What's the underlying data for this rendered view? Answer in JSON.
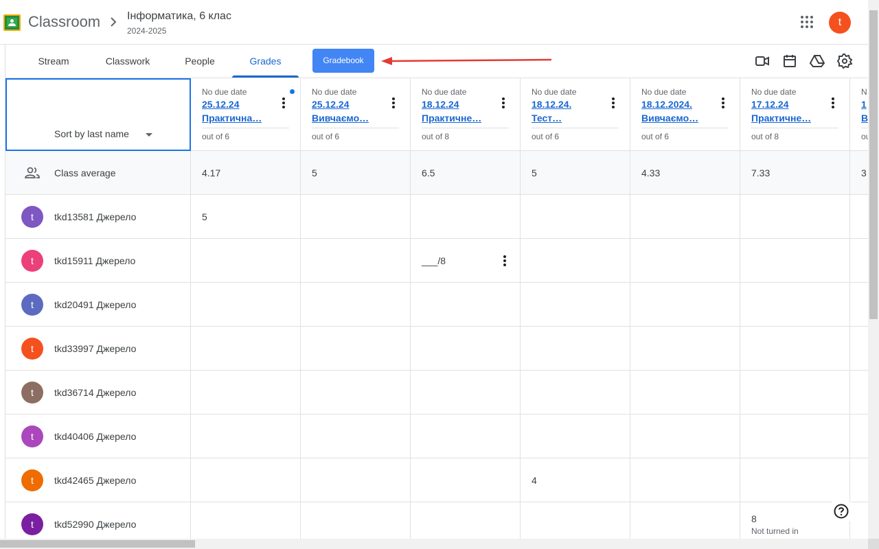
{
  "app": {
    "brand": "Classroom",
    "class_title": "Інформатика, 6 клас",
    "class_subtitle": "2024-2025",
    "account_initial": "t"
  },
  "tabs": [
    {
      "label": "Stream"
    },
    {
      "label": "Classwork"
    },
    {
      "label": "People"
    },
    {
      "label": "Grades",
      "active": true
    }
  ],
  "gradebook_label": "Gradebook",
  "toolbar_icons": [
    "video-icon",
    "calendar-icon",
    "drive-icon",
    "settings-icon"
  ],
  "sort_label": "Sort by last name",
  "columns": [
    {
      "due": "No due date",
      "title1": "25.12.24",
      "title2": "Практична…",
      "out_of": "out of 6",
      "new": true
    },
    {
      "due": "No due date",
      "title1": "25.12.24",
      "title2": "Вивчаємо…",
      "out_of": "out of 6"
    },
    {
      "due": "No due date",
      "title1": "18.12.24",
      "title2": "Практичне…",
      "out_of": "out of 8"
    },
    {
      "due": "No due date",
      "title1": "18.12.24.",
      "title2": "Тест…",
      "out_of": "out of 6"
    },
    {
      "due": "No due date",
      "title1": "18.12.2024.",
      "title2": "Вивчаємо…",
      "out_of": "out of 6"
    },
    {
      "due": "No due date",
      "title1": "17.12.24",
      "title2": "Практичне…",
      "out_of": "out of 8"
    },
    {
      "due": "N",
      "title1": "1",
      "title2": "В",
      "out_of": "ou"
    }
  ],
  "class_average": {
    "label": "Class average",
    "values": [
      "4.17",
      "5",
      "6.5",
      "5",
      "4.33",
      "7.33",
      "3"
    ]
  },
  "students": [
    {
      "name": "tkd13581 Джерело",
      "initial": "t",
      "color": "#7e57c2",
      "grades": [
        "5",
        "",
        "",
        "",
        "",
        "",
        ""
      ]
    },
    {
      "name": "tkd15911 Джерело",
      "initial": "t",
      "color": "#ec407a",
      "grades": [
        "",
        "",
        "___/8",
        "",
        "",
        "",
        ""
      ]
    },
    {
      "name": "tkd20491 Джерело",
      "initial": "t",
      "color": "#5c6bc0",
      "grades": [
        "",
        "",
        "",
        "",
        "",
        "",
        ""
      ]
    },
    {
      "name": "tkd33997 Джерело",
      "initial": "t",
      "color": "#f4511e",
      "grades": [
        "",
        "",
        "",
        "",
        "",
        "",
        ""
      ]
    },
    {
      "name": "tkd36714 Джерело",
      "initial": "t",
      "color": "#8d6e63",
      "grades": [
        "",
        "",
        "",
        "",
        "",
        "",
        ""
      ]
    },
    {
      "name": "tkd40406 Джерело",
      "initial": "t",
      "color": "#ab47bc",
      "grades": [
        "",
        "",
        "",
        "",
        "",
        "",
        ""
      ]
    },
    {
      "name": "tkd42465 Джерело",
      "initial": "t",
      "color": "#ef6c00",
      "grades": [
        "",
        "",
        "",
        "4",
        "",
        "",
        ""
      ]
    },
    {
      "name": "tkd52990 Джерело",
      "initial": "t",
      "color": "#7b1fa2",
      "grades": [
        "",
        "",
        "",
        "",
        "",
        "8",
        ""
      ],
      "notes": [
        "",
        "",
        "",
        "",
        "",
        "Not turned in",
        ""
      ]
    }
  ],
  "colors": {
    "accent": "#1967d2",
    "gradebook_button": "#4285f4",
    "annotation_arrow": "#e53935",
    "selection_border": "#1a73e8"
  }
}
